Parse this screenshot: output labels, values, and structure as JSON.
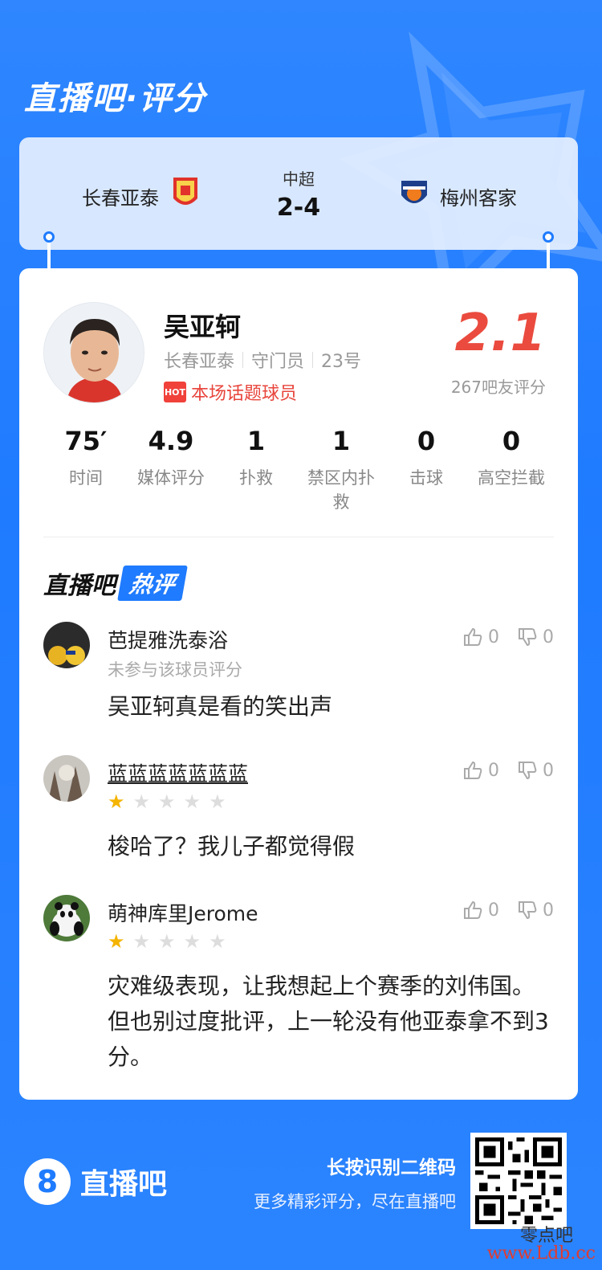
{
  "header": {
    "title": "直播吧·评分"
  },
  "match": {
    "home_team": "长春亚泰",
    "away_team": "梅州客家",
    "league": "中超",
    "score": "2-4"
  },
  "player": {
    "name": "吴亚轲",
    "team": "长春亚泰",
    "position": "守门员",
    "number": "23号",
    "hot_badge": "HOT",
    "hot_label": "本场话题球员",
    "rating": "2.1",
    "rating_count": "267吧友评分"
  },
  "stats": [
    {
      "value": "75′",
      "label": "时间"
    },
    {
      "value": "4.9",
      "label": "媒体评分"
    },
    {
      "value": "1",
      "label": "扑救"
    },
    {
      "value": "1",
      "label": "禁区内扑救"
    },
    {
      "value": "0",
      "label": "击球"
    },
    {
      "value": "0",
      "label": "高空拦截"
    }
  ],
  "hot_comments": {
    "title_left": "直播吧",
    "title_right": "热评",
    "items": [
      {
        "user": "芭提雅洗泰浴",
        "note": "未参与该球员评分",
        "stars": null,
        "text": "吴亚轲真是看的笑出声",
        "likes": "0",
        "dislikes": "0"
      },
      {
        "user": "蓝蓝蓝蓝蓝蓝蓝",
        "note": "",
        "stars": 1,
        "text": "梭哈了？我儿子都觉得假",
        "likes": "0",
        "dislikes": "0"
      },
      {
        "user": "萌神库里Jerome",
        "note": "",
        "stars": 1,
        "text": "灾难级表现，让我想起上个赛季的刘伟国。但也别过度批评，上一轮没有他亚泰拿不到3分。",
        "likes": "0",
        "dislikes": "0"
      }
    ]
  },
  "footer": {
    "logo_mark": "8",
    "brand": "直播吧",
    "scan_text": "长按识别二维码",
    "more_text": "更多精彩评分，尽在直播吧",
    "watermark_cn": "零点吧",
    "watermark_url": "www.Ldb.cc"
  },
  "colors": {
    "accent": "#1f7bff",
    "rating": "#ea4b3e",
    "star": "#f4b400"
  }
}
